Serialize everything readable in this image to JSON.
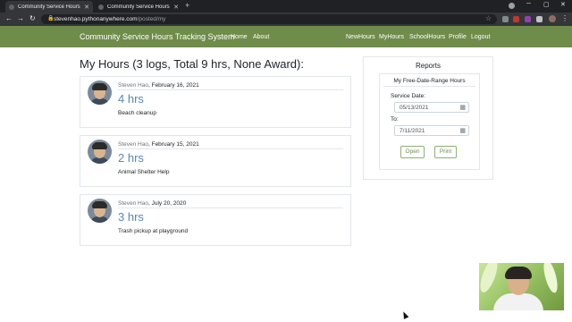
{
  "browser": {
    "tabs": [
      {
        "label": "Community Service Hours",
        "active": true
      },
      {
        "label": "Community Service Hours",
        "active": false
      }
    ],
    "url_domain": "stevenhao.pythonanywhere.com",
    "url_path": "/posted/my",
    "icons": [
      "back-icon",
      "forward-icon",
      "reload-icon",
      "lock-icon",
      "star-icon",
      "menu-dots-icon"
    ]
  },
  "navbar": {
    "brand": "Community Service Hours Tracking System",
    "left_links": [
      "Home",
      "About"
    ],
    "right_links": [
      "NewHours",
      "MyHours",
      "SchoolHours",
      "Profile",
      "Logout"
    ],
    "color": "#6f8c4a"
  },
  "main": {
    "title": "My Hours (3 logs, Total 9 hrs, None Award):",
    "logs": [
      {
        "author": "Steven Hao",
        "date": "February 16, 2021",
        "hours": "4 hrs",
        "description": "Beach cleanup"
      },
      {
        "author": "Steven Hao",
        "date": "February 15, 2021",
        "hours": "2 hrs",
        "description": "Animal Shelter Help"
      },
      {
        "author": "Steven Hao",
        "date": "July 20, 2020",
        "hours": "3 hrs",
        "description": "Trash pickup at playground"
      }
    ]
  },
  "reports": {
    "title": "Reports",
    "range_title": "My Free-Date-Range Hours",
    "service_date_label": "Service Date:",
    "service_date_value": "05/13/2021",
    "to_label": "To:",
    "to_value": "7/11/2021",
    "open_label": "Open",
    "print_label": "Print"
  }
}
